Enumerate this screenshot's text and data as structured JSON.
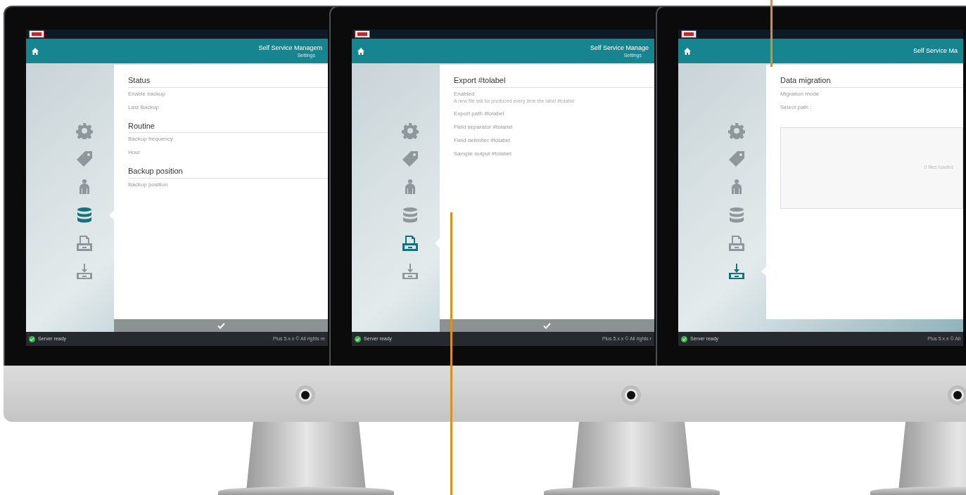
{
  "monitors": [
    {
      "app_title": "Self Service Managem",
      "subtitle": "Settings",
      "nav": [
        {
          "selected": false
        },
        {
          "selected": false
        },
        {
          "selected": false
        },
        {
          "selected": true
        },
        {
          "selected": false
        },
        {
          "selected": false
        }
      ],
      "content": [
        {
          "kind": "heading",
          "text": "Status"
        },
        {
          "kind": "row",
          "text": "Enable backup"
        },
        {
          "kind": "row",
          "text": "Last Backup"
        },
        {
          "kind": "heading",
          "text": "Routine"
        },
        {
          "kind": "row",
          "text": "Backup frequency"
        },
        {
          "kind": "row",
          "text": "Hour"
        },
        {
          "kind": "heading",
          "text": "Backup position"
        },
        {
          "kind": "row",
          "text": "Backup position"
        }
      ],
      "confirm_bar": true,
      "status": "Server ready",
      "footer": "Plus 5.x.x © All rights re"
    },
    {
      "app_title": "Self Service Manage",
      "subtitle": "Settings",
      "nav": [
        {
          "selected": false
        },
        {
          "selected": false
        },
        {
          "selected": false
        },
        {
          "selected": false
        },
        {
          "selected": true
        },
        {
          "selected": false
        }
      ],
      "content": [
        {
          "kind": "heading",
          "text": "Export #tolabel"
        },
        {
          "kind": "row",
          "text": "Enabled",
          "hint": "A new file will be produced every time the label #tolabel"
        },
        {
          "kind": "row",
          "text": "Export path #tolabel"
        },
        {
          "kind": "row",
          "text": "Field separator #tolabel"
        },
        {
          "kind": "row",
          "text": "Field delimiter #tolabel"
        },
        {
          "kind": "row",
          "text": "Sample output #tolabel"
        }
      ],
      "confirm_bar": true,
      "status": "Server ready",
      "footer": "Plus 5.x.x © All rights r"
    },
    {
      "app_title": "Self Service Ma",
      "nav": [
        {
          "selected": false
        },
        {
          "selected": false
        },
        {
          "selected": false
        },
        {
          "selected": false
        },
        {
          "selected": false
        },
        {
          "selected": true
        }
      ],
      "content": [
        {
          "kind": "heading",
          "text": "Data migration"
        },
        {
          "kind": "row",
          "text": "Migration mode"
        },
        {
          "kind": "row",
          "text": "Select path :"
        },
        {
          "kind": "dropzone",
          "text": "0 files loaded"
        }
      ],
      "confirm_bar": false,
      "status": "Server ready",
      "footer": "Plus 5.x.x © All"
    }
  ]
}
